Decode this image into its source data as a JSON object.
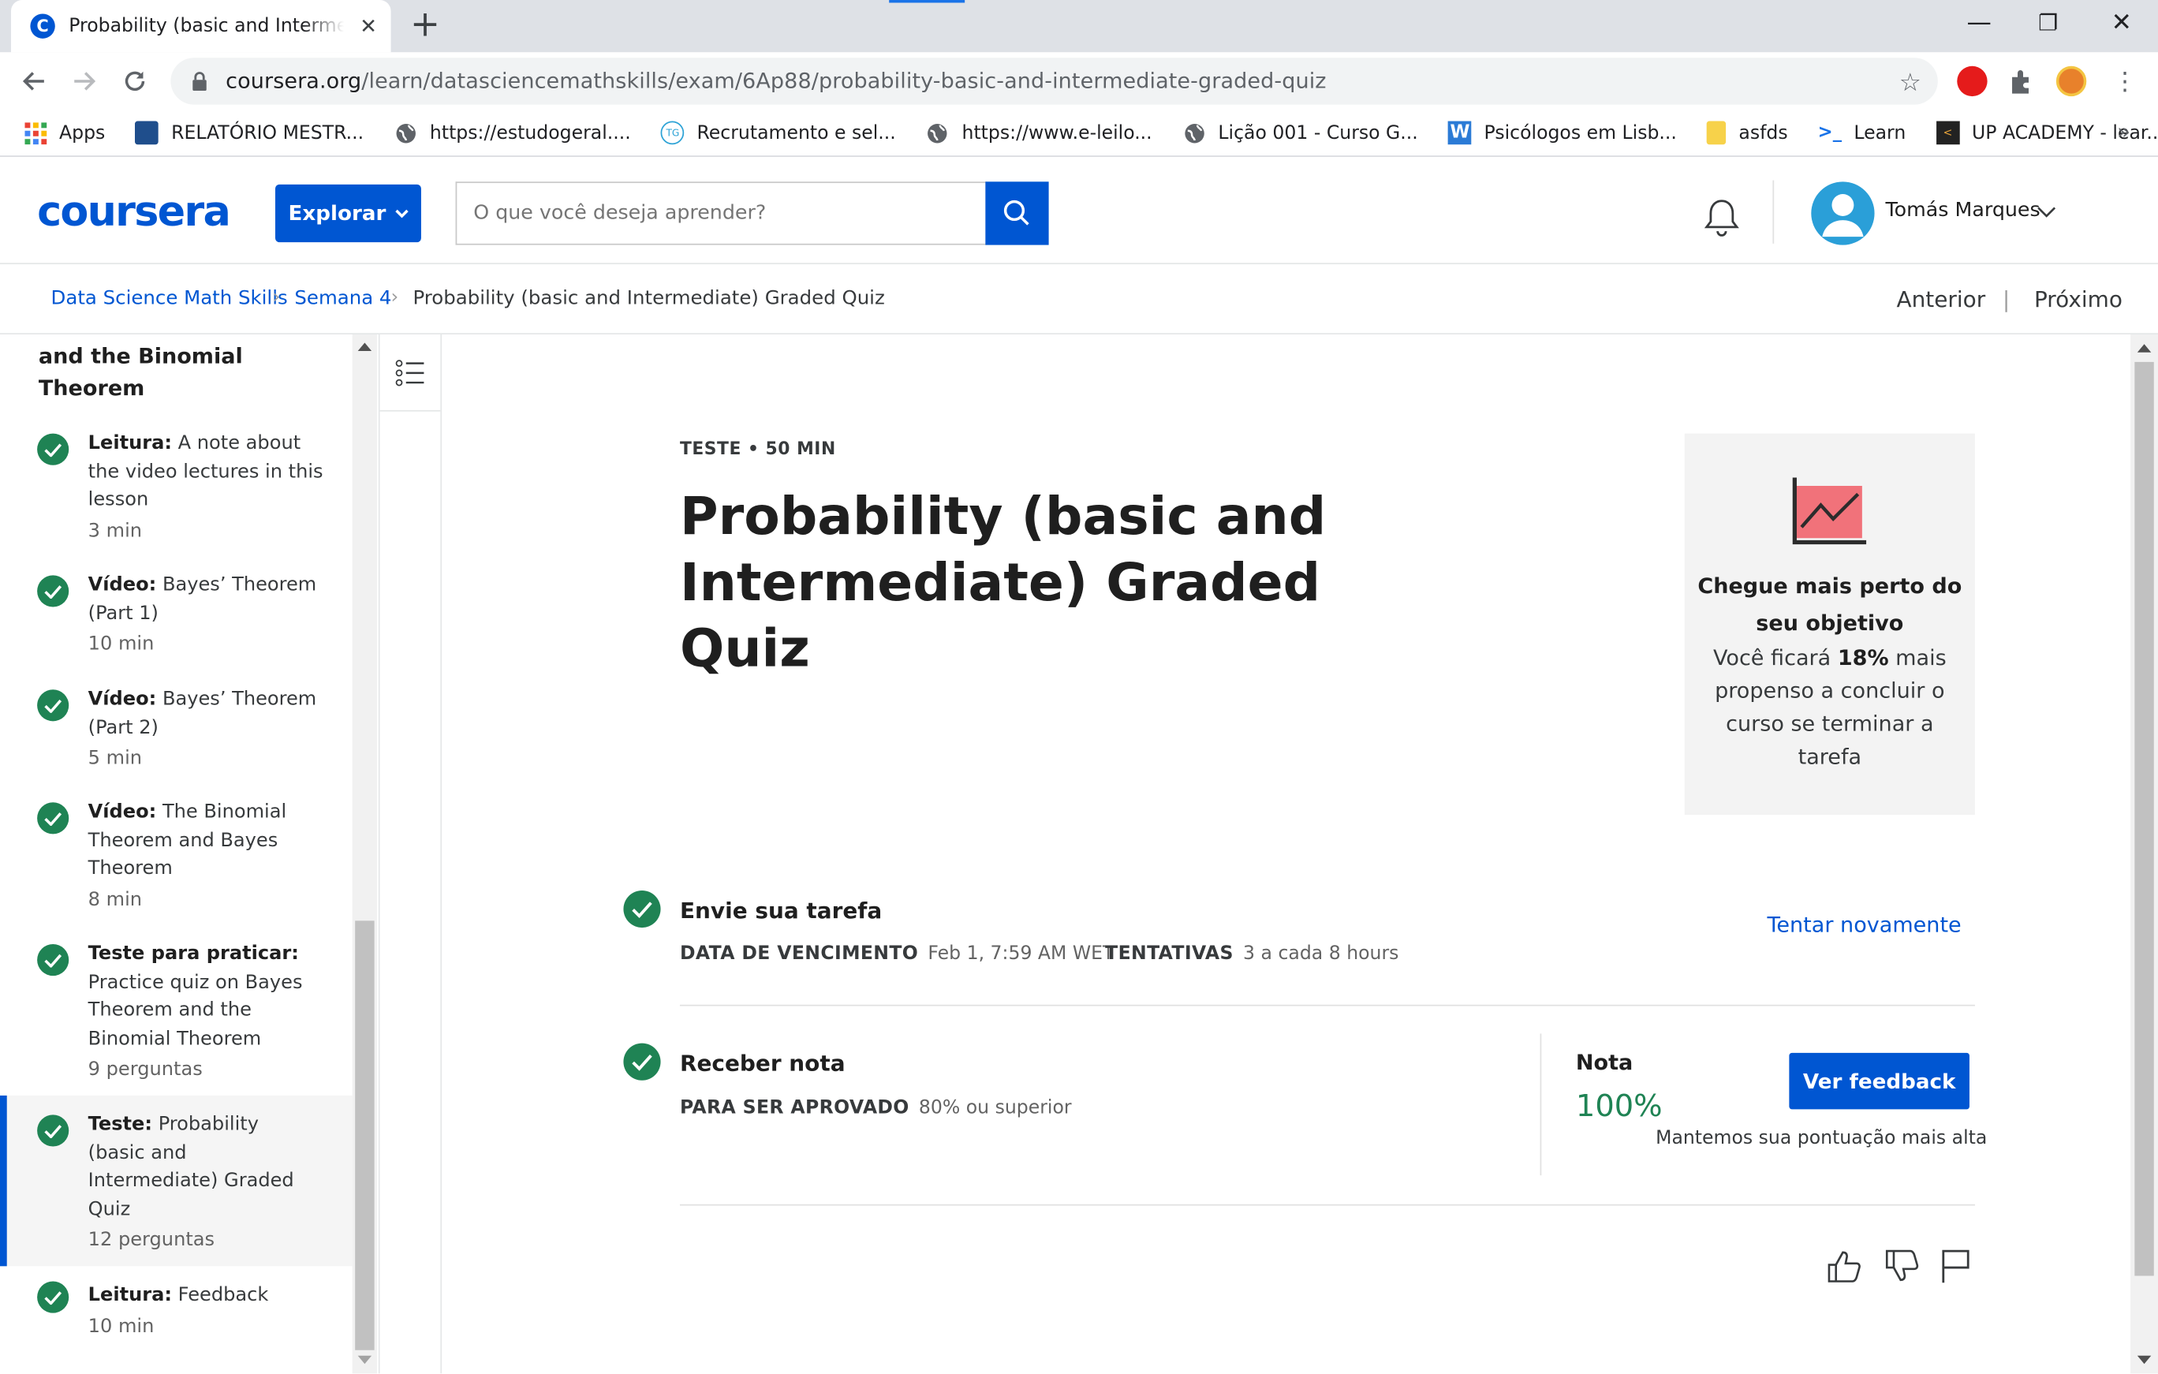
{
  "browser": {
    "tab_title": "Probability (basic and Intermediate) Graded Quiz",
    "tab_favicon_letter": "C",
    "url_host": "coursera.org",
    "url_path": "/learn/datasciencemathskills/exam/6Ap88/probability-basic-and-intermediate-graded-quiz",
    "bookmarks": [
      {
        "label": "Apps",
        "icon": "apps-grid-icon"
      },
      {
        "label": "RELATÓRIO MESTR...",
        "icon": "site-icon"
      },
      {
        "label": "https://estudogeral....",
        "icon": "globe-icon"
      },
      {
        "label": "Recrutamento e sel...",
        "icon": "site-icon"
      },
      {
        "label": "https://www.e-leilo...",
        "icon": "globe-icon"
      },
      {
        "label": "Lição 001 - Curso G...",
        "icon": "globe-icon"
      },
      {
        "label": "Psicólogos em Lisb...",
        "icon": "site-icon"
      },
      {
        "label": "asfds",
        "icon": "note-icon"
      },
      {
        "label": "Learn",
        "icon": "terminal-icon"
      },
      {
        "label": "UP ACADEMY - lear...",
        "icon": "site-icon"
      }
    ],
    "bookmarks_more": "»"
  },
  "header": {
    "logo": "coursera",
    "explore_label": "Explorar",
    "search_placeholder": "O que você deseja aprender?",
    "user_name": "Tomás Marques"
  },
  "breadcrumb": {
    "items": [
      "Data Science Math Skills",
      "Semana 4",
      "Probability (basic and Intermediate) Graded Quiz"
    ],
    "prev": "Anterior",
    "next": "Próximo",
    "divider": "|"
  },
  "sidebar": {
    "section_title_line1": "and the Binomial",
    "section_title_line2": "Theorem",
    "items": [
      {
        "type": "Leitura:",
        "title": "A note about the video lectures in this lesson",
        "duration": "3 min",
        "done": true
      },
      {
        "type": "Vídeo:",
        "title": "Bayes’ Theorem (Part 1)",
        "duration": "10 min",
        "done": true
      },
      {
        "type": "Vídeo:",
        "title": "Bayes’ Theorem (Part 2)",
        "duration": "5 min",
        "done": true
      },
      {
        "type": "Vídeo:",
        "title": "The Binomial Theorem and Bayes Theorem",
        "duration": "8 min",
        "done": true
      },
      {
        "type": "Teste para praticar:",
        "title": "Practice quiz on Bayes Theorem and the Binomial Theorem",
        "duration": "9 perguntas",
        "done": true
      },
      {
        "type": "Teste:",
        "title": "Probability (basic and Intermediate) Graded Quiz",
        "duration": "12 perguntas",
        "done": true,
        "active": true
      },
      {
        "type": "Leitura:",
        "title": "Feedback",
        "duration": "10 min",
        "done": true
      }
    ]
  },
  "main": {
    "kicker": "TESTE • 50 MIN",
    "title": "Probability (basic and Intermediate) Graded Quiz",
    "goal_card": {
      "heading": "Chegue mais perto do seu objetivo",
      "text_before": "Você ficará ",
      "text_bold": "18%",
      "text_after": " mais propenso a concluir o curso se terminar a tarefa"
    },
    "submit": {
      "heading": "Envie sua tarefa",
      "due_label": "DATA DE VENCIMENTO",
      "due_value": "Feb 1, 7:59 AM WET",
      "attempts_label": "TENTATIVAS",
      "attempts_value": "3 a cada 8 hours",
      "retry_label": "Tentar novamente"
    },
    "grade": {
      "heading": "Receber nota",
      "pass_label": "PARA SER APROVADO",
      "pass_value": "80% ou superior",
      "grade_label": "Nota",
      "grade_value": "100%",
      "feedback_button": "Ver feedback",
      "keep_note": "Mantemos sua pontuação mais alta"
    }
  },
  "colors": {
    "brand_blue": "#0056d2",
    "success_green": "#1f8354",
    "chart_icon_red": "#f06a73"
  }
}
